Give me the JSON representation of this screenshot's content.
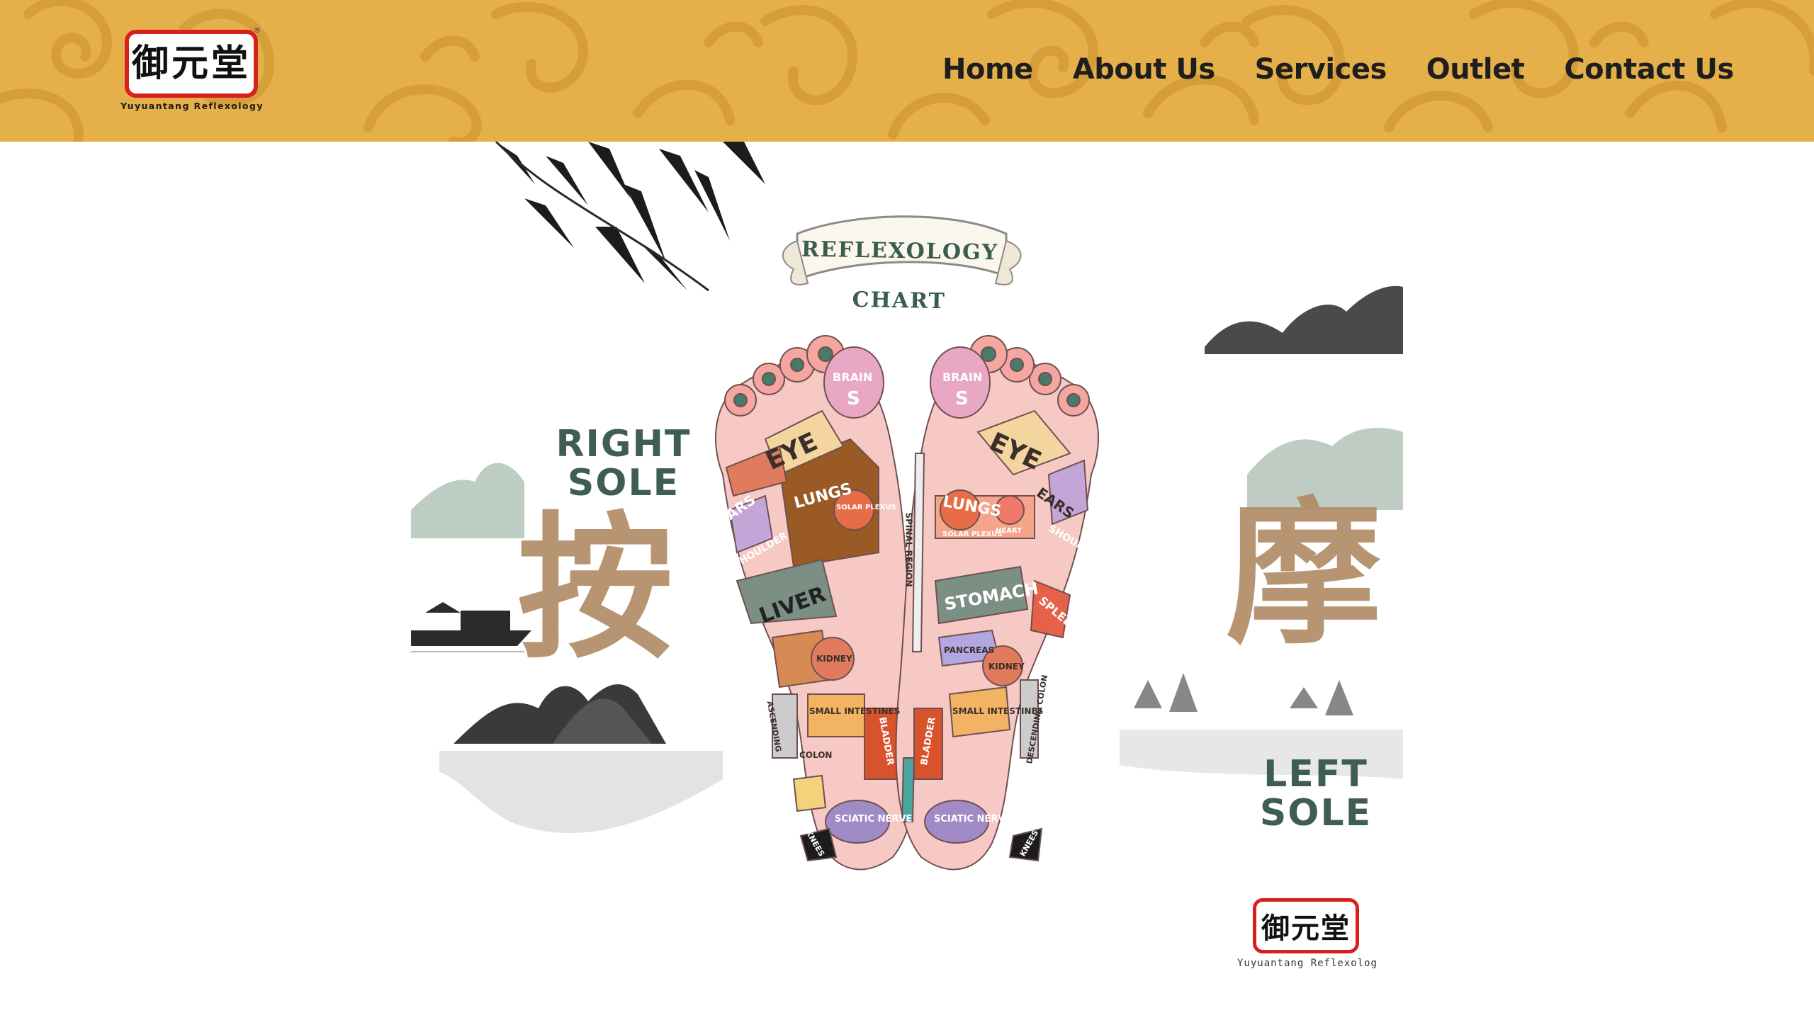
{
  "header": {
    "logo": {
      "glyphs": "御元堂",
      "caption": "Yuyuantang Reflexology",
      "registered_mark": "®"
    },
    "nav": [
      {
        "label": "Home"
      },
      {
        "label": "About Us"
      },
      {
        "label": "Services"
      },
      {
        "label": "Outlet"
      },
      {
        "label": "Contact Us"
      }
    ]
  },
  "colors": {
    "header_bg": "#e5b04a",
    "header_pattern": "#d49c36",
    "nav_text": "#1e1e1e",
    "accent_red": "#d8201f",
    "sole_text": "#3f5e52",
    "calligraphy": "#b08a63",
    "foot_pink": "#f7c9c4"
  },
  "hero": {
    "chart_title": "REFLEXOLOGY CHART",
    "right_sole_label": "RIGHT SOLE",
    "left_sole_label": "LEFT SOLE",
    "calligraphy_left": "按",
    "calligraphy_right": "摩",
    "right_foot_zones": {
      "brain": "BRAIN",
      "s": "S",
      "eye": "EYE",
      "ears": "EARS",
      "lungs": "LUNGS",
      "solar_plexus": "SOLAR PLEXUS",
      "shoulder": "SHOULDER",
      "liver": "LIVER",
      "kidney": "KIDNEY",
      "small_intestines": "SMALL INTESTINES",
      "colon": "COLON",
      "ascending": "ASCENDING",
      "bladder": "BLADDER",
      "sciatic_nerve": "SCIATIC NERVE",
      "knees": "KNEES"
    },
    "left_foot_zones": {
      "brain": "BRAIN",
      "s": "S",
      "eye": "EYE",
      "ears": "EARS",
      "lungs": "LUNGS",
      "solar_plexus": "SOLAR PLEXUS",
      "heart": "HEART",
      "shoulder": "SHOULDER",
      "stomach": "STOMACH",
      "spleen": "SPLEEN",
      "pancreas": "PANCREAS",
      "kidney": "KIDNEY",
      "small_intestines": "SMALL INTESTINES",
      "descending_colon": "DESCENDING COLON",
      "spinal_region": "SPINAL REGION",
      "bladder": "BLADDER",
      "sciatic_nerve": "SCIATIC NERVE",
      "knees": "KNEES"
    },
    "bottom_logo": {
      "glyphs": "御元堂",
      "caption": "Yuyuantang Reflexolog"
    }
  }
}
